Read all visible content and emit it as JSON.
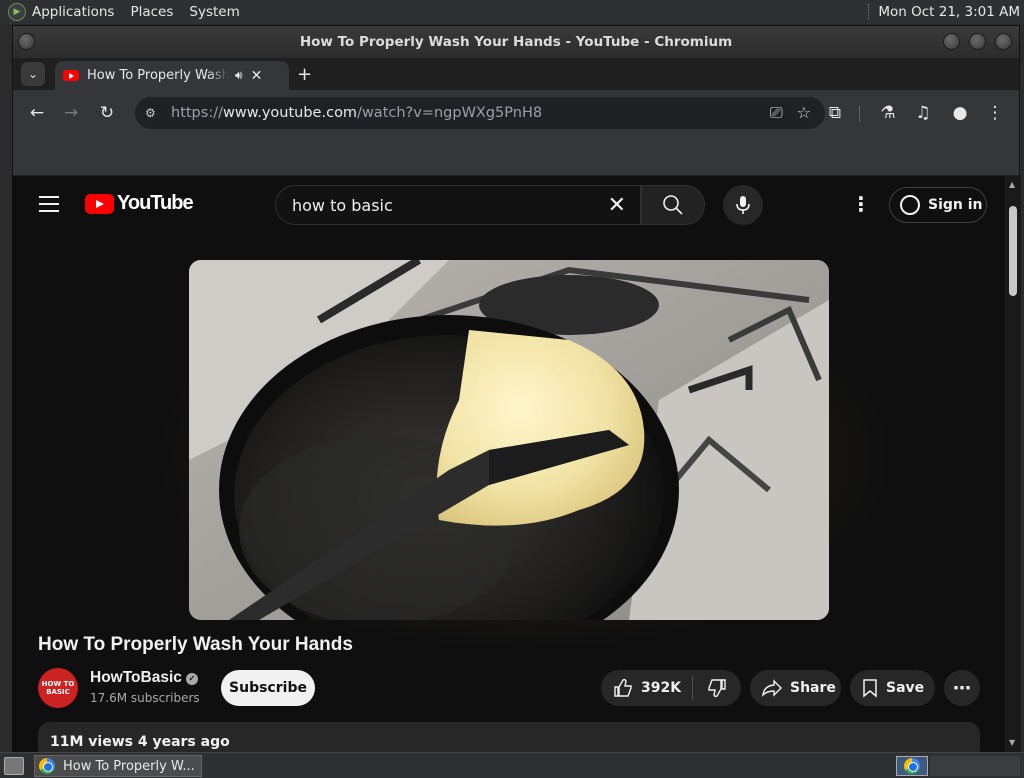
{
  "top_panel": {
    "menus": [
      "Applications",
      "Places",
      "System"
    ],
    "clock": "Mon Oct 21,  3:01 AM"
  },
  "window": {
    "title": "How To Properly Wash Your Hands - YouTube - Chromium"
  },
  "tab": {
    "title": "How To Properly Wash Your Hands - YouTube",
    "new_tab": "+"
  },
  "omnibox": {
    "url_prefix": "https://",
    "url_host": "www.youtube.com",
    "url_path": "/watch?v=ngpWXg5PnH8"
  },
  "youtube": {
    "logo_text": "YouTube",
    "search_query": "how to basic",
    "sign_in_label": "Sign in",
    "video_title": "How To Properly Wash Your Hands",
    "channel_name": "HowToBasic",
    "channel_avatar_text": "HOW TO BASIC",
    "subscribers": "17.6M subscribers",
    "subscribe_label": "Subscribe",
    "like_count": "392K",
    "share_label": "Share",
    "save_label": "Save",
    "description_preview": "11M views  4 years ago"
  },
  "taskbar": {
    "task_label": "How To Properly W..."
  },
  "colors": {
    "youtube_red": "#ff0000",
    "page_bg": "#0f0f0f",
    "chrome_toolbar": "#35363a"
  }
}
